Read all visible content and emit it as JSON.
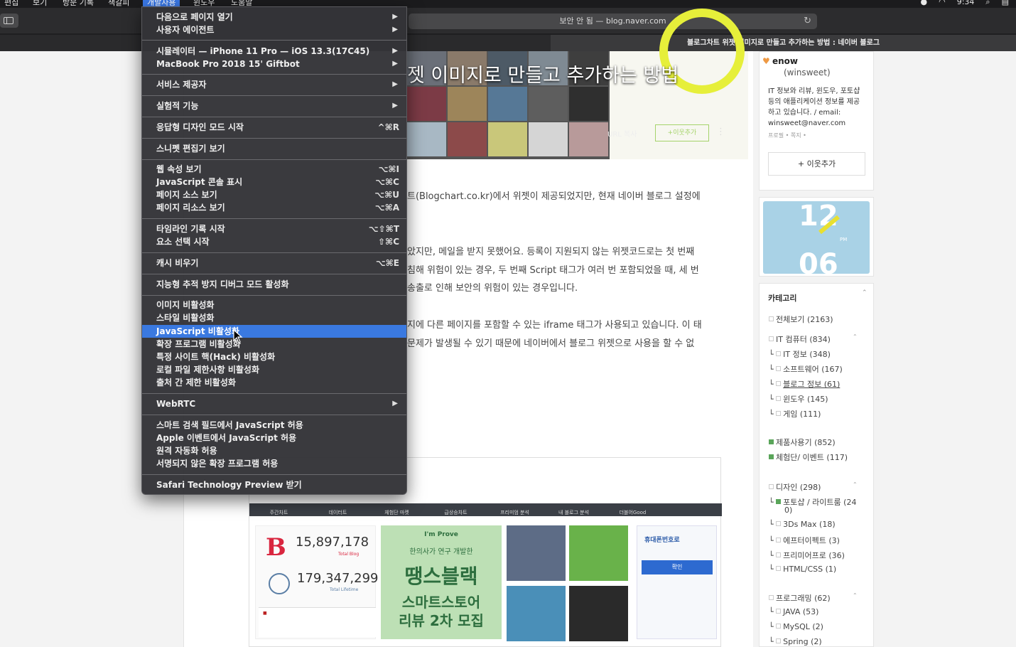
{
  "menubar": {
    "items": [
      "편집",
      "보기",
      "방문 기록",
      "책갈피",
      "개발자용",
      "윈도우",
      "도움말"
    ],
    "time": "9:34"
  },
  "toolbar": {
    "address": "보안 안 됨 — blog.naver.com"
  },
  "tab": {
    "title": "블로그차트 위젯 이미지로 만들고 추가하는 방법 : 네이버 블로그"
  },
  "header": {
    "title": "젯 이미지로 만들고 추가하는 방법",
    "url_copy": "URL 복사",
    "neighbor": "+이웃추가"
  },
  "post": {
    "p1": "트(Blogchart.co.kr)에서 위젯이 제공되었지만, 현재 네이버 블로그 설정에",
    "p2a": "았지만, 메일을 받지 못했어요. 등록이 지원되지 않는 위젯코드로는 첫 번째",
    "p2b": "침해 위험이 있는 경우, 두 번째 Script 태그가 여러 번 포함되었을 때, 세 번",
    "p2c": "송출로 인해 보안의 위험이 있는 경우입니다.",
    "p3a": "지에 다른 페이지를 포함할 수 있는 iframe 태그가 사용되고 있습니다. 이 태",
    "p3b": "문제가 발생될 수 있기 때문에 네이버에서 블로그 위젯으로 사용을 할 수 없"
  },
  "embed": {
    "nav": [
      "주간차트",
      "데이터트",
      "체험단 마켓",
      "급상승차트",
      "프리미엄 분석",
      "내 블로그 분석",
      "더블어Good"
    ],
    "counter1": "15,897,178",
    "counter1_label": "Total Blog",
    "counter2": "179,347,299",
    "counter2_label": "Total Lifetime",
    "green_ad_brand": "I'm Prove",
    "green_ad_sub": "한의사가 연구 개발한",
    "green_ad_main": "땡스블랙",
    "green_ad_line2": "스마트스토어",
    "green_ad_line3": "리뷰 2차 모집",
    "phone_title": "휴대폰번호로",
    "phone_btn": "확인"
  },
  "profile": {
    "name": "enow",
    "id": "(winsweet)",
    "desc": "IT 정보와 리뷰, 윈도우, 포토샵 등의 애플리케이션 정보를 제공하고 있습니다. / email: winsweet@naver.com",
    "links": "프로필 • 쪽지 •",
    "add": "+ 이웃추가"
  },
  "clock": {
    "hour": "12",
    "minute": "06",
    "ampm": "PM"
  },
  "categories": {
    "title": "카테고리",
    "items": [
      "전체보기 (2163)",
      "IT 컴퓨터 (834)",
      "IT 정보 (348)",
      "소프트웨어 (167)",
      "블로그 정보 (61)",
      "윈도우 (145)",
      "게임 (111)",
      "제품사용기 (852)",
      "체험단/ 이벤트 (117)",
      "디자인 (298)",
      "포토샵 / 라이트룸 (24",
      "0)",
      "3Ds Max (18)",
      "에프터이펙트 (3)",
      "프리미어프로 (36)",
      "HTML/CSS (1)",
      "프로그래밍 (62)",
      "JAVA (53)",
      "MySQL (2)",
      "Spring (2)"
    ]
  },
  "menu": {
    "items": [
      {
        "label": "다음으로 페이지 열기",
        "shortcut": "",
        "submenu": true
      },
      {
        "label": "사용자 에이전트",
        "shortcut": "",
        "submenu": true
      },
      {
        "label": "시뮬레이터 — iPhone 11 Pro — iOS 13.3(17C45)",
        "shortcut": "",
        "submenu": true
      },
      {
        "label": "MacBook Pro 2018 15' Giftbot",
        "shortcut": "",
        "submenu": true
      },
      {
        "label": "서비스 제공자",
        "shortcut": "",
        "submenu": true
      },
      {
        "label": "실험적 기능",
        "shortcut": "",
        "submenu": true
      },
      {
        "label": "응답형 디자인 모드 시작",
        "shortcut": "^⌘R",
        "submenu": false
      },
      {
        "label": "스니펫 편집기 보기",
        "shortcut": "",
        "submenu": false
      },
      {
        "label": "웹 속성 보기",
        "shortcut": "⌥⌘I",
        "submenu": false
      },
      {
        "label": "JavaScript 콘솔 표시",
        "shortcut": "⌥⌘C",
        "submenu": false
      },
      {
        "label": "페이지 소스 보기",
        "shortcut": "⌥⌘U",
        "submenu": false
      },
      {
        "label": "페이지 리소스 보기",
        "shortcut": "⌥⌘A",
        "submenu": false
      },
      {
        "label": "타임라인 기록 시작",
        "shortcut": "⌥⇧⌘T",
        "submenu": false
      },
      {
        "label": "요소 선택 시작",
        "shortcut": "⇧⌘C",
        "submenu": false
      },
      {
        "label": "캐시 비우기",
        "shortcut": "⌥⌘E",
        "submenu": false
      },
      {
        "label": "지능형 추적 방지 디버그 모드 활성화",
        "shortcut": "",
        "submenu": false
      },
      {
        "label": "이미지 비활성화",
        "shortcut": "",
        "submenu": false
      },
      {
        "label": "스타일 비활성화",
        "shortcut": "",
        "submenu": false
      },
      {
        "label": "JavaScript 비활성화",
        "shortcut": "",
        "submenu": false,
        "highlighted": true
      },
      {
        "label": "확장 프로그램 비활성화",
        "shortcut": "",
        "submenu": false
      },
      {
        "label": "특정 사이트 핵(Hack) 비활성화",
        "shortcut": "",
        "submenu": false
      },
      {
        "label": "로컬 파일 제한사항 비활성화",
        "shortcut": "",
        "submenu": false
      },
      {
        "label": "출처 간 제한 비활성화",
        "shortcut": "",
        "submenu": false
      },
      {
        "label": "WebRTC",
        "shortcut": "",
        "submenu": true
      },
      {
        "label": "스마트 검색 필드에서 JavaScript 허용",
        "shortcut": "",
        "submenu": false
      },
      {
        "label": "Apple 이벤트에서 JavaScript 허용",
        "shortcut": "",
        "submenu": false
      },
      {
        "label": "원격 자동화 허용",
        "shortcut": "",
        "submenu": false
      },
      {
        "label": "서명되지 않은 확장 프로그램 허용",
        "shortcut": "",
        "submenu": false
      },
      {
        "label": "Safari Technology Preview 받기",
        "shortcut": "",
        "submenu": false
      }
    ]
  },
  "colors": {
    "menu_highlight": "#3a79e0",
    "menu_bg": "#343438",
    "accent_green": "#a5d36b"
  }
}
